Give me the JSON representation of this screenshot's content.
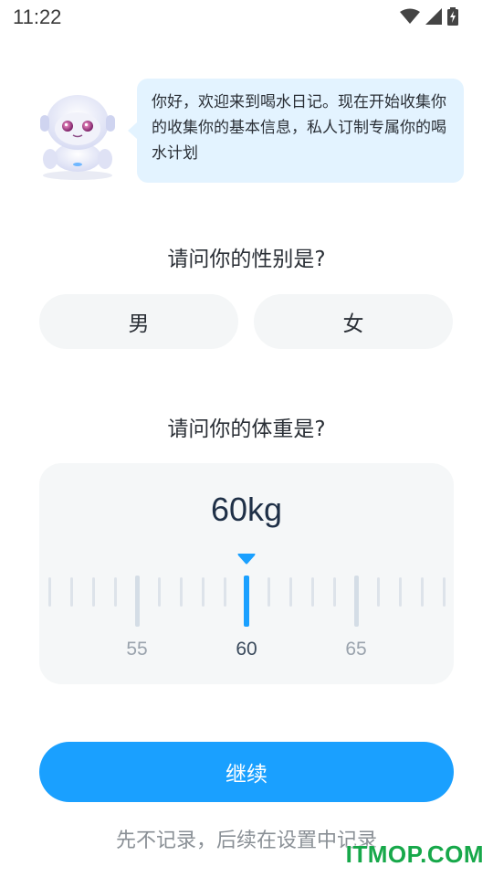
{
  "status_bar": {
    "time": "11:22",
    "icons": [
      "wifi-icon",
      "cellular-signal-icon",
      "battery-charging-icon"
    ]
  },
  "greeting": {
    "avatar": "robot-avatar",
    "message": "你好，欢迎来到喝水日记。现在开始收集你的收集你的基本信息，私人订制专属你的喝水计划"
  },
  "gender_question": {
    "label": "请问你的性别是?",
    "options": [
      "男",
      "女"
    ]
  },
  "weight_question": {
    "label": "请问你的体重是?",
    "value_display": "60kg",
    "selected_value": 60,
    "unit": "kg",
    "ruler": {
      "min_visible": 51,
      "max_visible": 69,
      "labels": [
        "55",
        "60",
        "65"
      ]
    }
  },
  "actions": {
    "continue_label": "继续",
    "skip_label": "先不记录，后续在设置中记录"
  },
  "watermark": "ITMOP.COM",
  "colors": {
    "accent": "#1aa0ff",
    "bubble_bg": "#e3f3ff",
    "option_bg": "#f4f6f7",
    "watermark": "#17a84a"
  }
}
